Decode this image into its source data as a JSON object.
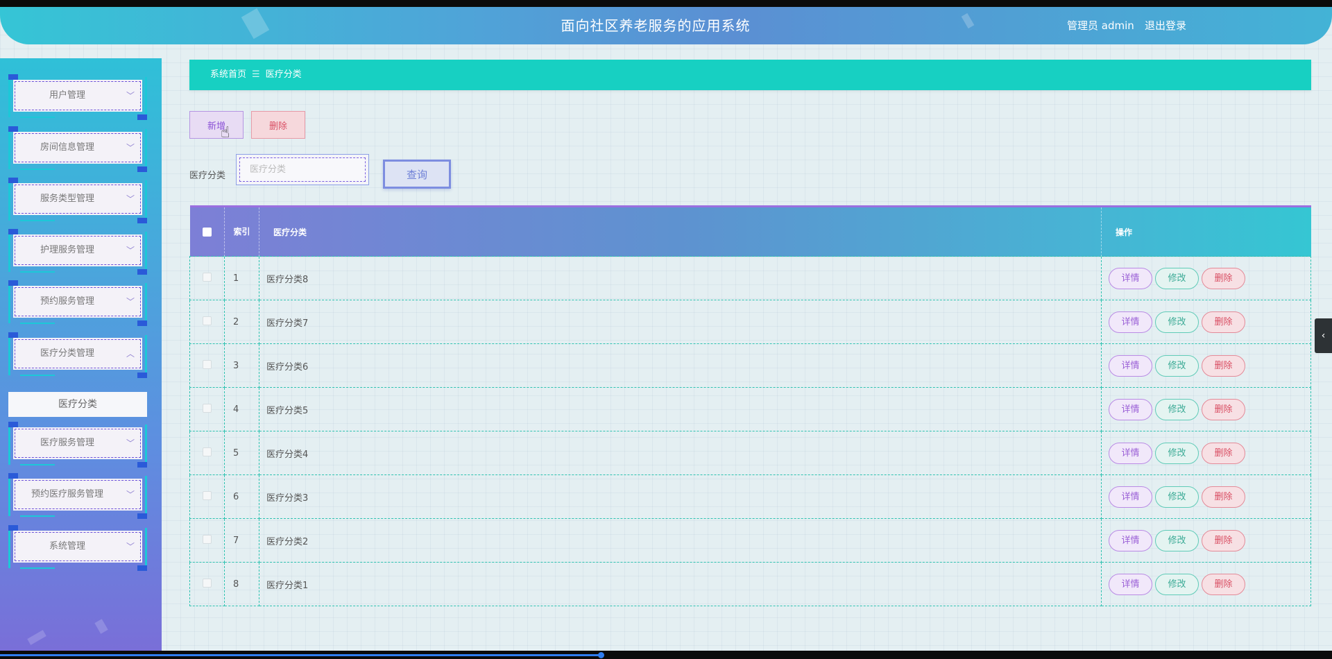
{
  "header": {
    "title": "面向社区养老服务的应用系统",
    "user": "管理员 admin",
    "logout": "退出登录"
  },
  "sidebar": {
    "items": [
      {
        "label": "用户管理",
        "chevron": "chevron-down-icon"
      },
      {
        "label": "房间信息管理",
        "chevron": "chevron-down-icon"
      },
      {
        "label": "服务类型管理",
        "chevron": "chevron-down-icon"
      },
      {
        "label": "护理服务管理",
        "chevron": "chevron-down-icon"
      },
      {
        "label": "预约服务管理",
        "chevron": "chevron-down-icon"
      },
      {
        "label": "医疗分类管理",
        "chevron": "chevron-up-icon"
      },
      {
        "label": "医疗服务管理",
        "chevron": "chevron-down-icon"
      },
      {
        "label": "预约医疗服务管理",
        "chevron": "chevron-down-icon"
      },
      {
        "label": "系统管理",
        "chevron": "chevron-down-icon"
      }
    ],
    "active_sub": "医疗分类"
  },
  "breadcrumb": {
    "home": "系统首页",
    "separator": "☰",
    "current": "医疗分类"
  },
  "toolbar": {
    "add_label": "新增",
    "delete_label": "删除"
  },
  "search": {
    "label": "医疗分类",
    "placeholder": "医疗分类",
    "value": "",
    "button": "查询"
  },
  "table": {
    "headers": {
      "index": "索引",
      "name": "医疗分类",
      "ops": "操作"
    },
    "rows": [
      {
        "index": "1",
        "name": "医疗分类8"
      },
      {
        "index": "2",
        "name": "医疗分类7"
      },
      {
        "index": "3",
        "name": "医疗分类6"
      },
      {
        "index": "4",
        "name": "医疗分类5"
      },
      {
        "index": "5",
        "name": "医疗分类4"
      },
      {
        "index": "6",
        "name": "医疗分类3"
      },
      {
        "index": "7",
        "name": "医疗分类2"
      },
      {
        "index": "8",
        "name": "医疗分类1"
      }
    ],
    "row_actions": {
      "detail": "详情",
      "edit": "修改",
      "delete": "删除"
    }
  },
  "colors": {
    "accent_teal": "#17d0c2",
    "header_gradient_start": "#35c5d6",
    "sidebar_gradient_end": "#7a6ed8",
    "detail": "#9a5fd6",
    "edit": "#3aaa95",
    "delete": "#d94f64"
  }
}
